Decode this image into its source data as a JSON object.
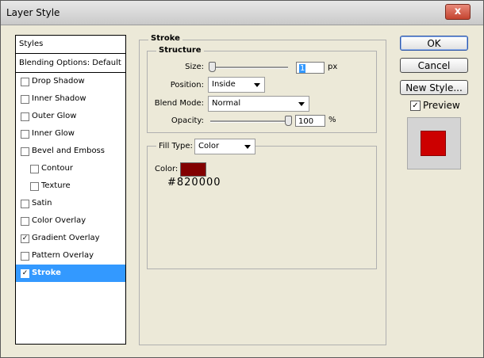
{
  "window": {
    "title": "Layer Style",
    "close_glyph": "x"
  },
  "styles_panel": {
    "header": "Styles",
    "blending_options": "Blending Options: Default",
    "items": [
      {
        "label": "Drop Shadow",
        "checked": false,
        "selected": false,
        "indent": false
      },
      {
        "label": "Inner Shadow",
        "checked": false,
        "selected": false,
        "indent": false
      },
      {
        "label": "Outer Glow",
        "checked": false,
        "selected": false,
        "indent": false
      },
      {
        "label": "Inner Glow",
        "checked": false,
        "selected": false,
        "indent": false
      },
      {
        "label": "Bevel and Emboss",
        "checked": false,
        "selected": false,
        "indent": false
      },
      {
        "label": "Contour",
        "checked": false,
        "selected": false,
        "indent": true
      },
      {
        "label": "Texture",
        "checked": false,
        "selected": false,
        "indent": true
      },
      {
        "label": "Satin",
        "checked": false,
        "selected": false,
        "indent": false
      },
      {
        "label": "Color Overlay",
        "checked": false,
        "selected": false,
        "indent": false
      },
      {
        "label": "Gradient Overlay",
        "checked": true,
        "selected": false,
        "indent": false
      },
      {
        "label": "Pattern Overlay",
        "checked": false,
        "selected": false,
        "indent": false
      },
      {
        "label": "Stroke",
        "checked": true,
        "selected": true,
        "indent": false
      }
    ]
  },
  "stroke": {
    "section_title": "Stroke",
    "structure_title": "Structure",
    "size_label": "Size:",
    "size_value": "1",
    "size_unit": "px",
    "position_label": "Position:",
    "position_value": "Inside",
    "blend_mode_label": "Blend Mode:",
    "blend_mode_value": "Normal",
    "opacity_label": "Opacity:",
    "opacity_value": "100",
    "opacity_unit": "%",
    "size_slider_level": 0,
    "opacity_slider_level": 1.0
  },
  "fill": {
    "fill_type_label": "Fill Type:",
    "fill_type_value": "Color",
    "color_label": "Color:",
    "color_hex": "#820000",
    "color_swatch": "#820000"
  },
  "buttons": {
    "ok": "OK",
    "cancel": "Cancel",
    "new_style": "New Style..."
  },
  "preview": {
    "label": "Preview",
    "checked": true,
    "fill_color": "#cc0000",
    "checkmark": "✓"
  },
  "colors": {
    "selection": "#3399ff",
    "swatch": "#820000",
    "preview_fill": "#cc0000"
  }
}
